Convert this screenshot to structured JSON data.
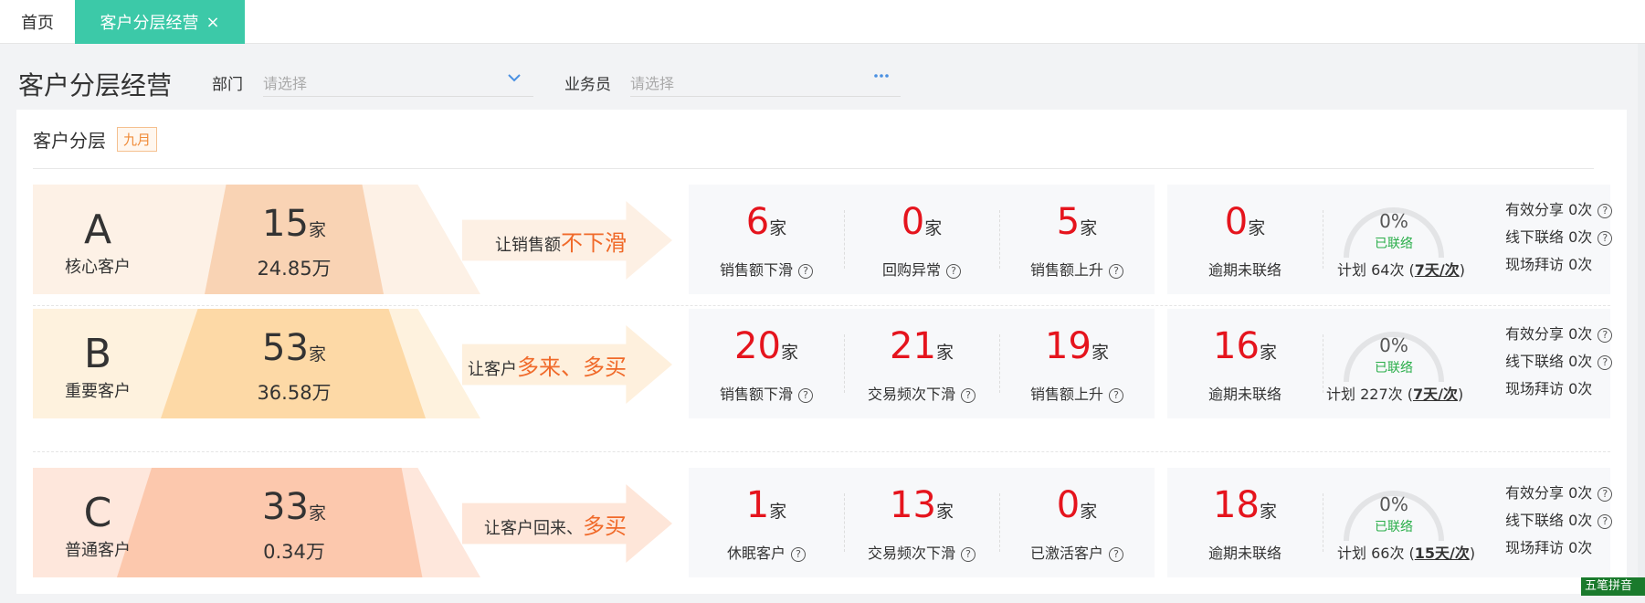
{
  "tabs": {
    "home": "首页",
    "active": "客户分层经营",
    "close": "×"
  },
  "header": {
    "title": "客户分层经营",
    "dept_label": "部门",
    "dept_placeholder": "请选择",
    "salesman_label": "业务员",
    "salesman_placeholder": "请选择"
  },
  "card": {
    "title": "客户分层",
    "month": "九月"
  },
  "rows": [
    {
      "grade": "A",
      "name": "核心客户",
      "count": "15",
      "count_unit": "家",
      "amount": "24.85万",
      "slogan_prefix": "让销售额",
      "slogan_hl": "不下滑",
      "metrics": [
        {
          "value": "6",
          "unit": "家",
          "label": "销售额下滑"
        },
        {
          "value": "0",
          "unit": "家",
          "label": "回购异常"
        },
        {
          "value": "5",
          "unit": "家",
          "label": "销售额上升"
        }
      ],
      "overdue": {
        "value": "0",
        "unit": "家",
        "label": "逾期未联络"
      },
      "gauge": {
        "percent": "0%",
        "state": "已联络"
      },
      "plan_prefix": "计划 64次 (",
      "plan_freq": "7天/次",
      "plan_suffix": ")",
      "stats": [
        "有效分享 0次",
        "线下联络 0次",
        "现场拜访 0次"
      ]
    },
    {
      "grade": "B",
      "name": "重要客户",
      "count": "53",
      "count_unit": "家",
      "amount": "36.58万",
      "slogan_prefix": "让客户",
      "slogan_hl": "多来、多买",
      "metrics": [
        {
          "value": "20",
          "unit": "家",
          "label": "销售额下滑"
        },
        {
          "value": "21",
          "unit": "家",
          "label": "交易频次下滑"
        },
        {
          "value": "19",
          "unit": "家",
          "label": "销售额上升"
        }
      ],
      "overdue": {
        "value": "16",
        "unit": "家",
        "label": "逾期未联络"
      },
      "gauge": {
        "percent": "0%",
        "state": "已联络"
      },
      "plan_prefix": "计划 227次 (",
      "plan_freq": "7天/次",
      "plan_suffix": ")",
      "stats": [
        "有效分享 0次",
        "线下联络 0次",
        "现场拜访 0次"
      ]
    },
    {
      "grade": "C",
      "name": "普通客户",
      "count": "33",
      "count_unit": "家",
      "amount": "0.34万",
      "slogan_prefix": "让客户回来、",
      "slogan_hl": "多买",
      "metrics": [
        {
          "value": "1",
          "unit": "家",
          "label": "休眠客户"
        },
        {
          "value": "13",
          "unit": "家",
          "label": "交易频次下滑"
        },
        {
          "value": "0",
          "unit": "家",
          "label": "已激活客户"
        }
      ],
      "overdue": {
        "value": "18",
        "unit": "家",
        "label": "逾期未联络"
      },
      "gauge": {
        "percent": "0%",
        "state": "已联络"
      },
      "plan_prefix": "计划 66次 (",
      "plan_freq": "15天/次",
      "plan_suffix": ")",
      "stats": [
        "有效分享 0次",
        "线下联络 0次",
        "现场拜访 0次"
      ]
    }
  ],
  "ime_badge": "五笔拼音",
  "colors": {
    "accent_tab": "#3cc9a8",
    "value_red": "#e5141d",
    "slogan_orange": "#f06a2a",
    "contacted_green": "#2aae4a",
    "row_a": "#fbe3cf",
    "row_b": "#fde3bd",
    "row_c": "#fdd6c2"
  },
  "icons": {
    "dept_dropdown": "chevron-down-icon",
    "salesman_picker": "ellipsis-icon",
    "help": "question-circle-icon"
  }
}
